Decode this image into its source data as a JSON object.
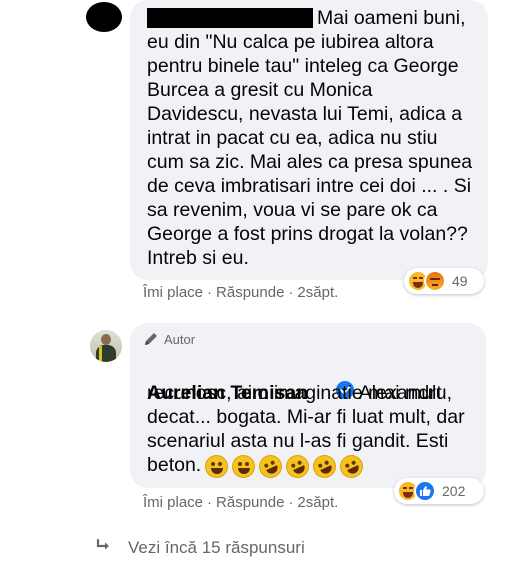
{
  "comment1": {
    "author_redacted": true,
    "text_lines": [
      "Mai oameni buni,",
      "eu din \"Nu calca pe iubirea altora",
      "pentru binele tau\" inteleg ca George",
      "Burcea a gresit cu Monica",
      "Davidescu, nevasta lui Temi, adica a",
      "intrat in pacat cu ea, adica nu stiu",
      "cum sa zic. Mai ales ca presa spunea",
      "de ceva imbratisari intre cei doi ... . Si",
      "sa revenim, voua vi se pare ok ca",
      "George a fost prins drogat la volan??",
      "Intreb si eu."
    ],
    "reactions": {
      "icons": [
        "haha-reaction-icon",
        "angry-reaction-icon"
      ],
      "count": "49"
    },
    "actions": {
      "like": "Îmi place",
      "reply": "Răspunde",
      "time": "2săpt.",
      "separator": "·"
    }
  },
  "comment2": {
    "badge": "Autor",
    "author_name": "Aurelian Temisan",
    "text_first": "Alexandru,",
    "text_lines": [
      "recunosc, ai o imaginatie mai mult",
      "decat... bogata. Mi-ar fi luat mult, dar",
      "scenariul asta nu l-as fi gandit. Esti",
      "beton."
    ],
    "emojis": [
      "grinning-emoji",
      "grinning-emoji",
      "rofl-emoji",
      "rofl-emoji",
      "rofl-emoji",
      "rofl-emoji"
    ],
    "reactions": {
      "icons": [
        "haha-reaction-icon",
        "like-reaction-icon"
      ],
      "count": "202"
    },
    "actions": {
      "like": "Îmi place",
      "reply": "Răspunde",
      "time": "2săpt.",
      "separator": "·"
    }
  },
  "more_replies": {
    "label": "Vezi încă 15 răspunsuri",
    "icon": "reply-arrow-icon"
  },
  "colors": {
    "bubble": "#f0f2f5",
    "secondary_text": "#65676b",
    "verified_blue": "#1877f2"
  }
}
